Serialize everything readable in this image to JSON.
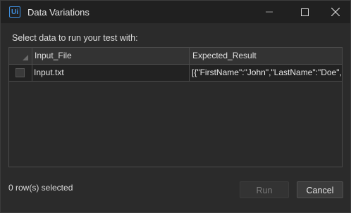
{
  "window": {
    "title": "Data Variations",
    "app_icon_label": "Ui",
    "controls": {
      "minimize_icon": "minimize-icon",
      "maximize_icon": "maximize-icon",
      "close_icon": "close-icon"
    }
  },
  "prompt": "Select data to run your test with:",
  "table": {
    "columns": [
      "Input_File",
      "Expected_Result"
    ],
    "rows": [
      {
        "selected": false,
        "cells": [
          "Input.txt",
          "[{\"FirstName\":\"John\",\"LastName\":\"Doe\",\""
        ]
      }
    ]
  },
  "status": "0 row(s) selected",
  "buttons": {
    "run": "Run",
    "cancel": "Cancel"
  },
  "colors": {
    "accent": "#3f8fdf",
    "background": "#2b2b2b",
    "titlebar": "#202020"
  }
}
